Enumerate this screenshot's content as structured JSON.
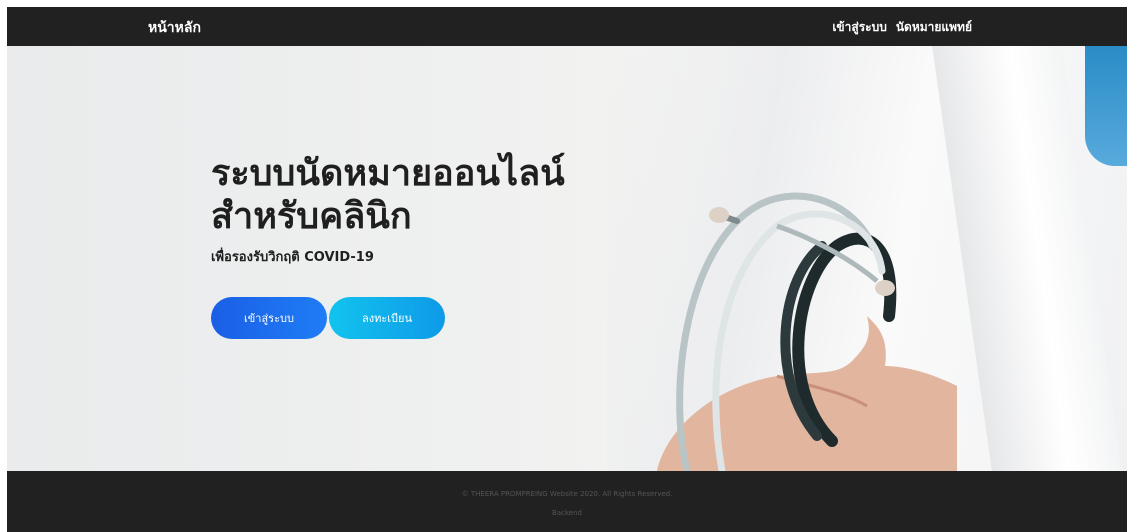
{
  "nav": {
    "brand": "หน้าหลัก",
    "links": [
      "เข้าสู่ระบบ",
      "นัดหมายแพทย์"
    ]
  },
  "hero": {
    "title_line1": "ระบบนัดหมายออนไลน์",
    "title_line2": "สำหรับคลินิก",
    "subtitle": "เพื่อรองรับวิกฤติ COVID-19",
    "login_button": "เข้าสู่ระบบ",
    "register_button": "ลงทะเบียน"
  },
  "footer": {
    "copyright": "© THEERA PROMPREING Website 2020. All Rights Reserved.",
    "backend_link": "Backend"
  },
  "colors": {
    "navbar": "#212121",
    "footer": "#212121",
    "login_button": "#1a5fe6",
    "register_button": "#12c3ee"
  }
}
